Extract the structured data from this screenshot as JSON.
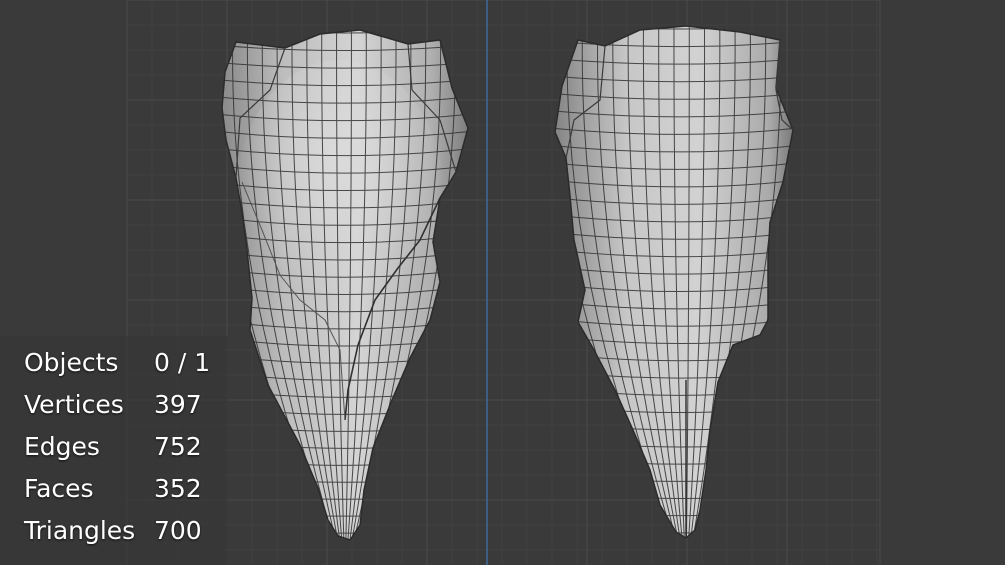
{
  "viewport": {
    "background_color": "#3a3a3a",
    "grid_color": "#454545",
    "axis_color": "#3d6ea0",
    "mesh_color": "#c9c9c9",
    "wire_color": "#2b2b2b"
  },
  "stats": {
    "rows": [
      {
        "label": "Objects",
        "value": "0 / 1"
      },
      {
        "label": "Vertices",
        "value": "397"
      },
      {
        "label": "Edges",
        "value": "752"
      },
      {
        "label": "Faces",
        "value": "352"
      },
      {
        "label": "Triangles",
        "value": "700"
      }
    ]
  }
}
